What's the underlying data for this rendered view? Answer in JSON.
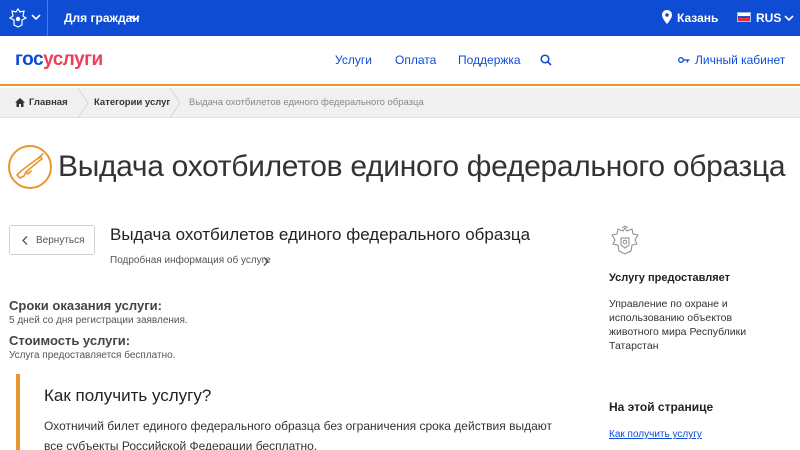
{
  "topbar": {
    "audience": "Для граждан",
    "city": "Казань",
    "language": "RUS",
    "icons": [
      "emblem-icon",
      "chevron-down-icon",
      "location-pin-icon",
      "flag-icon"
    ]
  },
  "header": {
    "logo_part1": "гос",
    "logo_part2": "услуги",
    "nav": [
      "Услуги",
      "Оплата",
      "Поддержка"
    ],
    "cabinet": "Личный кабинет",
    "colors": {
      "brand_blue": "#0d4cd3",
      "brand_red": "#ee3f58",
      "accent_orange": "#e8972c"
    }
  },
  "breadcrumb": {
    "items": [
      "Главная",
      "Категории услуг",
      "Выдача охотбилетов единого федерального образца"
    ]
  },
  "page": {
    "title": "Выдача охотбилетов единого федерального образца",
    "back": "Вернуться",
    "service_title": "Выдача охотбилетов единого федерального образца",
    "more_info": "Подробная информация об услуге",
    "terms_heading": "Сроки оказания услуги:",
    "terms_value": "5 дней со дня регистрации заявления.",
    "cost_heading": "Стоимость услуги:",
    "cost_value": "Услуга предоставляется бесплатно.",
    "howto_heading": "Как получить услугу?",
    "howto_text": "Охотничий билет единого федерального образца без ограничения срока действия выдают все субъекты Российской Федерации бесплатно."
  },
  "sidebar": {
    "provider_heading": "Услугу предоставляет",
    "provider_name": "Управление по охране и использованию объектов животного мира Республики Татарстан",
    "onpage_heading": "На этой странице",
    "onpage_link": "Как получить услугу"
  }
}
